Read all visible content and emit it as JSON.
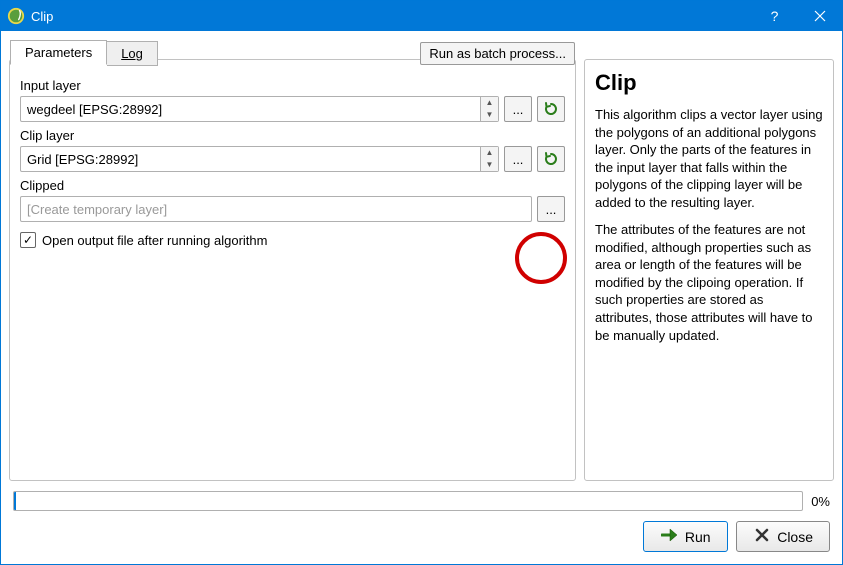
{
  "window": {
    "title": "Clip"
  },
  "batch_button": "Run as batch process...",
  "tabs": {
    "parameters": "Parameters",
    "log": "Log"
  },
  "form": {
    "input_layer": {
      "label": "Input layer",
      "value": "wegdeel [EPSG:28992]"
    },
    "clip_layer": {
      "label": "Clip layer",
      "value": "Grid [EPSG:28992]"
    },
    "clipped": {
      "label": "Clipped",
      "placeholder": "[Create temporary layer]"
    },
    "open_output_label": "Open output file after running algorithm"
  },
  "help": {
    "title": "Clip",
    "p1": "This algorithm clips a vector layer using the polygons of an additional polygons layer. Only the parts of the features in the input layer that falls within the polygons of the clipping layer will be added to the resulting layer.",
    "p2": "The attributes of the features are not modified, although properties such as area or length of the features will be modified by the clipoing operation. If such properties are stored as attributes, those attributes will have to be manually updated."
  },
  "progress_percent": "0%",
  "buttons": {
    "run": "Run",
    "close": "Close"
  }
}
